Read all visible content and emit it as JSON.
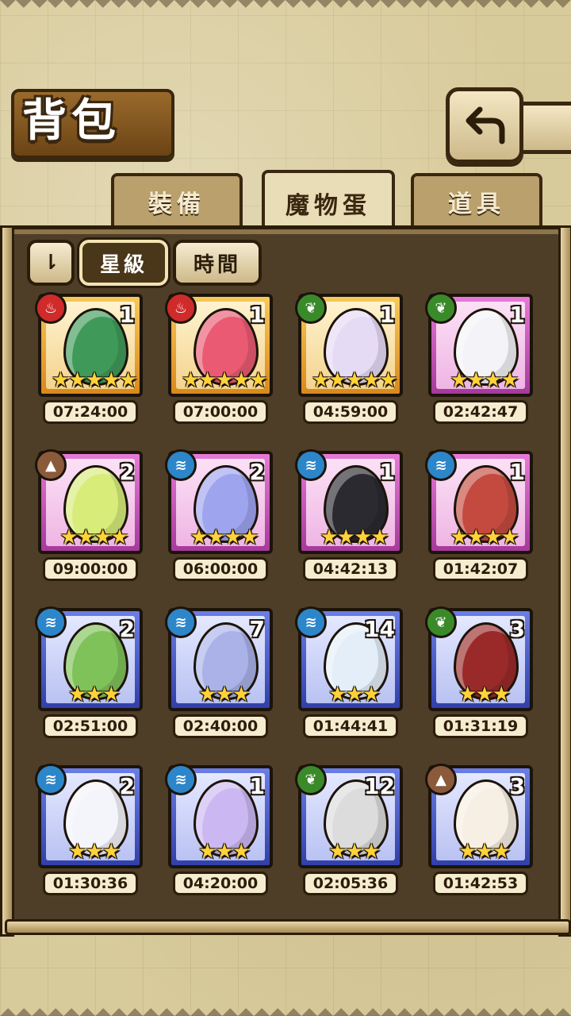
{
  "header": {
    "title": "背包"
  },
  "tabs": [
    {
      "label": "裝備",
      "active": false
    },
    {
      "label": "魔物蛋",
      "active": true
    },
    {
      "label": "道具",
      "active": false
    }
  ],
  "sort": {
    "toggle_icon": "sort-order-icon",
    "toggle_glyph": "⇂",
    "by_star": "星級",
    "by_time": "時間",
    "selected": "星級"
  },
  "colors": {
    "star": "#ffd23a",
    "gold_frame": "#e8a32e",
    "pink_frame": "#c458b8",
    "blue_frame": "#4a5ac8"
  },
  "eggs": [
    {
      "element": "fire",
      "count": "1",
      "stars": "★★★★★",
      "time": "07:24:00",
      "frame": "gold",
      "color": "#3f9a5a"
    },
    {
      "element": "fire",
      "count": "1",
      "stars": "★★★★★",
      "time": "07:00:00",
      "frame": "gold",
      "color": "#ea5a72"
    },
    {
      "element": "leaf",
      "count": "1",
      "stars": "★★★★★",
      "time": "04:59:00",
      "frame": "gold",
      "color": "#e6dbf5"
    },
    {
      "element": "leaf",
      "count": "1",
      "stars": "★★★★",
      "time": "02:42:47",
      "frame": "pink",
      "color": "#f4f4f8"
    },
    {
      "element": "earth",
      "count": "2",
      "stars": "★★★★",
      "time": "09:00:00",
      "frame": "pink",
      "color": "#d8ec7a"
    },
    {
      "element": "water",
      "count": "2",
      "stars": "★★★★",
      "time": "06:00:00",
      "frame": "pink",
      "color": "#9ea4ee"
    },
    {
      "element": "water",
      "count": "1",
      "stars": "★★★★",
      "time": "04:42:13",
      "frame": "pink",
      "color": "#2a2a30"
    },
    {
      "element": "water",
      "count": "1",
      "stars": "★★★★",
      "time": "01:42:07",
      "frame": "pink",
      "color": "#c44a40"
    },
    {
      "element": "water",
      "count": "2",
      "stars": "★★★",
      "time": "02:51:00",
      "frame": "blue",
      "color": "#7fc25a"
    },
    {
      "element": "water",
      "count": "7",
      "stars": "★★★",
      "time": "02:40:00",
      "frame": "blue",
      "color": "#aab2e8"
    },
    {
      "element": "water",
      "count": "14",
      "stars": "★★★",
      "time": "01:44:41",
      "frame": "blue",
      "color": "#e4eef8"
    },
    {
      "element": "leaf",
      "count": "3",
      "stars": "★★★",
      "time": "01:31:19",
      "frame": "blue",
      "color": "#9a2a2a"
    },
    {
      "element": "water",
      "count": "2",
      "stars": "★★★",
      "time": "01:30:36",
      "frame": "blue",
      "color": "#f4f4fb"
    },
    {
      "element": "water",
      "count": "1",
      "stars": "★★★",
      "time": "04:20:00",
      "frame": "blue",
      "color": "#cbb8f2"
    },
    {
      "element": "leaf",
      "count": "12",
      "stars": "★★★",
      "time": "02:05:36",
      "frame": "blue",
      "color": "#dcdcdc"
    },
    {
      "element": "earth",
      "count": "3",
      "stars": "★★★",
      "time": "01:42:53",
      "frame": "blue",
      "color": "#f8efe4"
    }
  ],
  "element_glyphs": {
    "fire": "♨",
    "leaf": "❦",
    "water": "≋",
    "earth": "▲"
  }
}
